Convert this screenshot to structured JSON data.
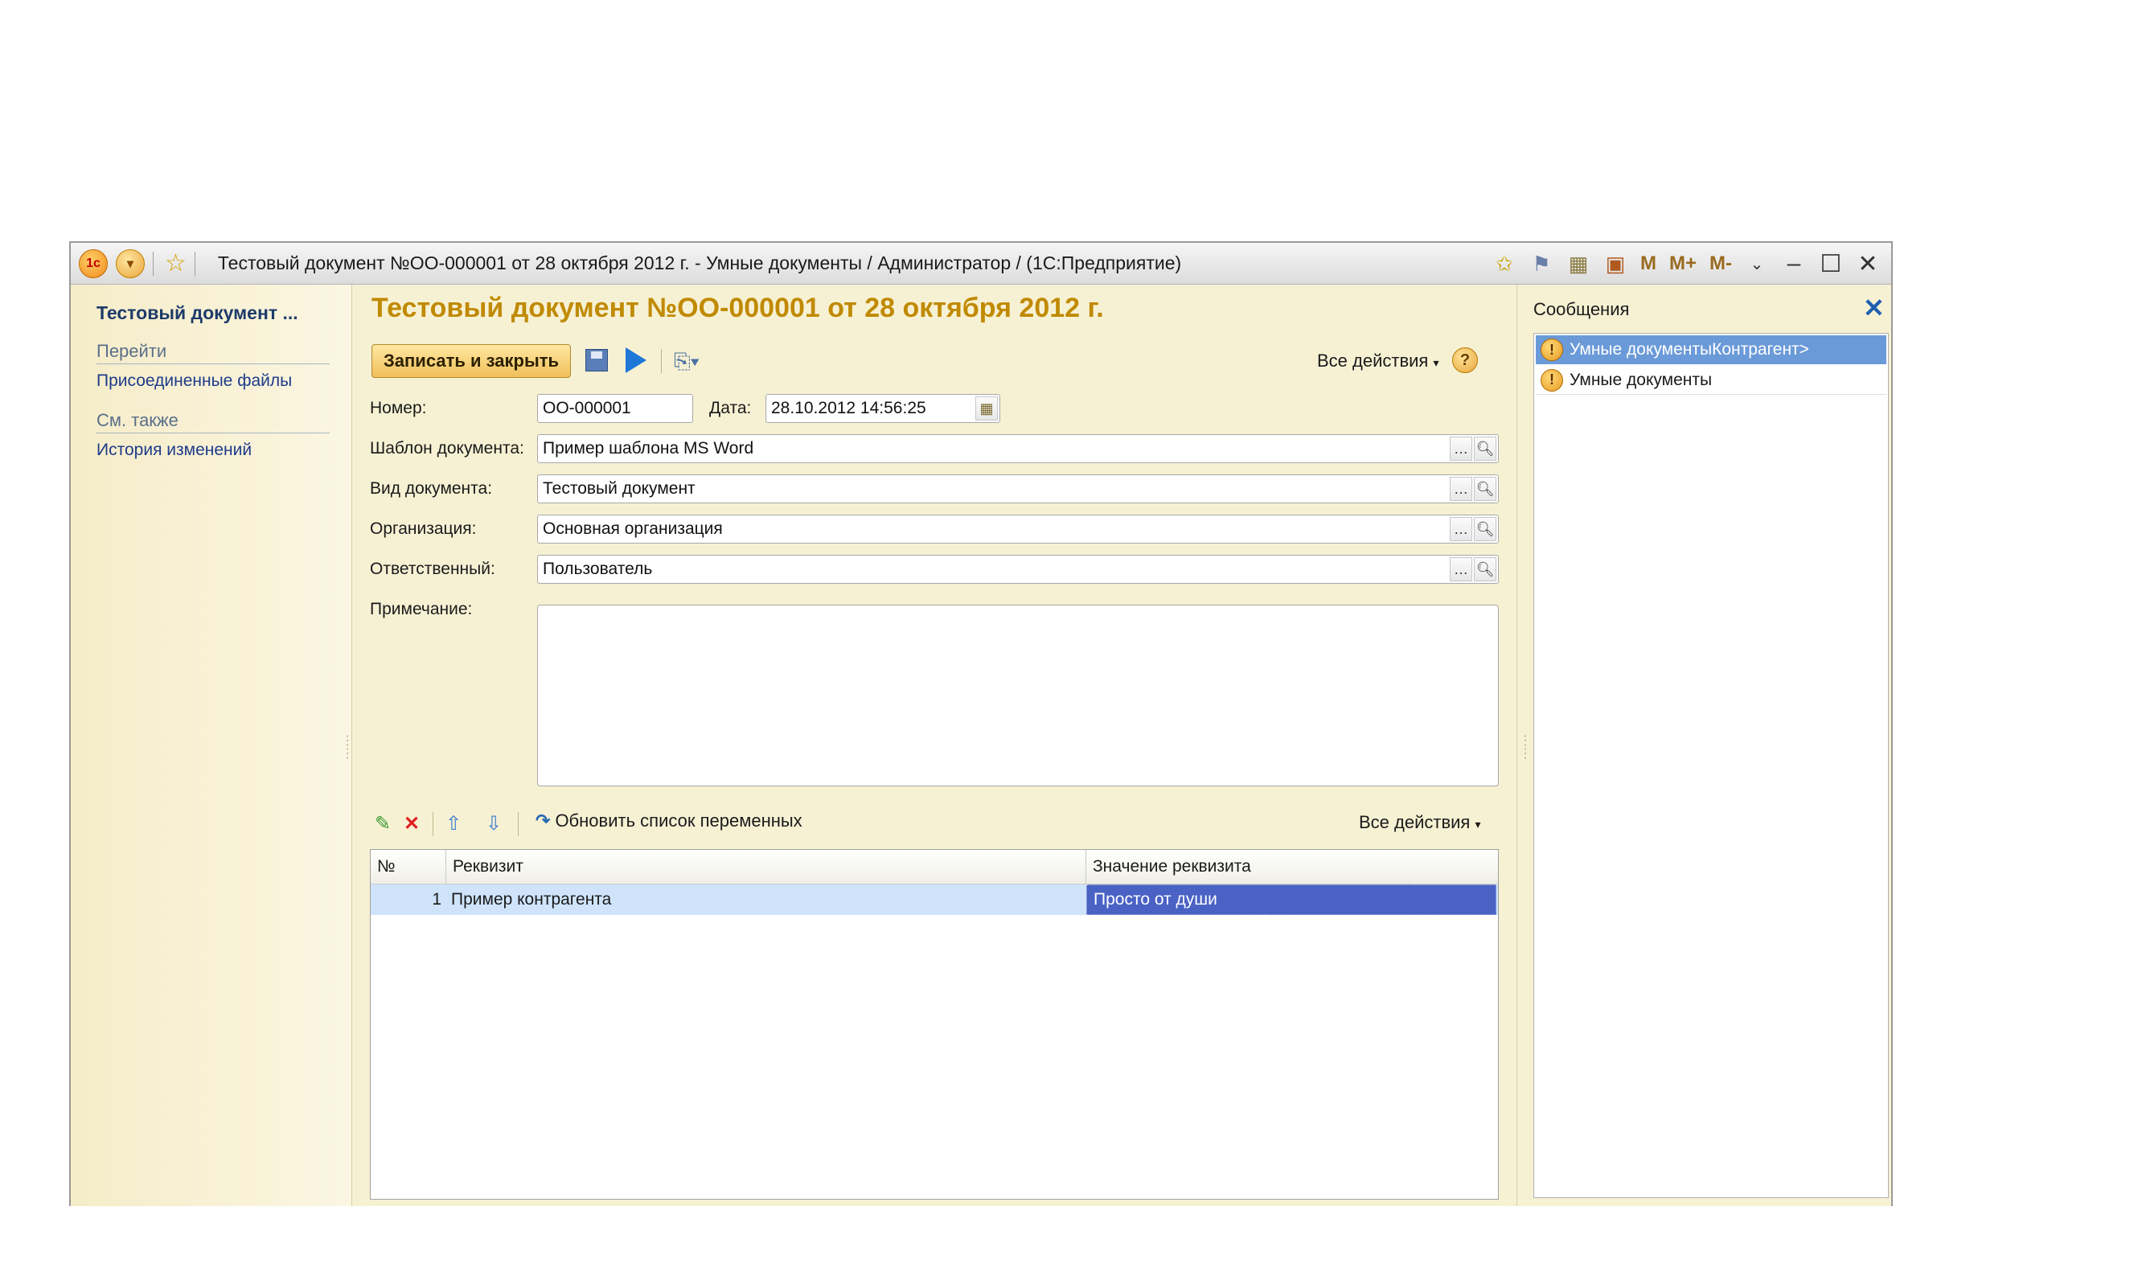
{
  "window": {
    "title": "Тестовый документ №ОО-000001 от 28 октября 2012 г. - Умные документы / Администратор /   (1С:Предприятие)",
    "buttons": {
      "m": "M",
      "mplus": "M+",
      "mminus": "M-"
    }
  },
  "left_panel": {
    "title": "Тестовый документ ...",
    "goto_header": "Перейти",
    "attached_files": "Присоединенные файлы",
    "see_also_header": "См. также",
    "history": "История изменений"
  },
  "form": {
    "title": "Тестовый документ №ОО-000001 от 28 октября 2012 г.",
    "save_close": "Записать и закрыть",
    "all_actions": "Все действия",
    "help": "?",
    "number_label": "Номер:",
    "number_value": "ОО-000001",
    "date_label": "Дата:",
    "date_value": "28.10.2012 14:56:25",
    "template_label": "Шаблон документа:",
    "template_value": "Пример шаблона MS Word",
    "doctype_label": "Вид документа:",
    "doctype_value": "Тестовый документ",
    "org_label": "Организация:",
    "org_value": "Основная организация",
    "resp_label": "Ответственный:",
    "resp_value": "Пользователь",
    "note_label": "Примечание:",
    "note_value": ""
  },
  "table": {
    "refresh_label": "Обновить список переменных",
    "all_actions": "Все действия",
    "columns": [
      "№",
      "Реквизит",
      "Значение реквизита"
    ],
    "rows": [
      {
        "num": "1",
        "attr": "Пример контрагента",
        "value": "Просто от души"
      }
    ]
  },
  "messages": {
    "title": "Сообщения",
    "items": [
      "Умные документыКонтрагент>",
      "Умные документы"
    ]
  },
  "colors": {
    "title_accent": "#c08a00",
    "selection": "#4a62c4",
    "row_highlight": "#cfe4fb",
    "message_selected": "#6b9ad8"
  }
}
